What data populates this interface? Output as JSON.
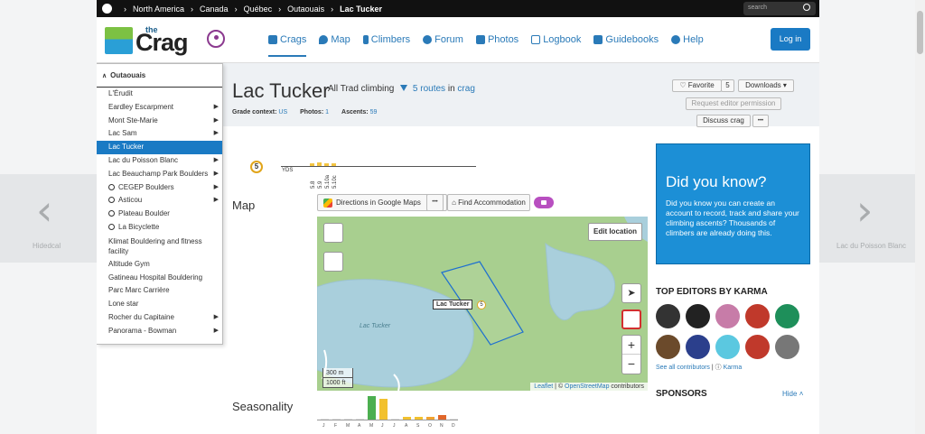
{
  "breadcrumb": {
    "items": [
      "North America",
      "Canada",
      "Québec",
      "Outaouais",
      "Lac Tucker"
    ]
  },
  "search": {
    "placeholder": "search"
  },
  "logo": {
    "the": "the",
    "name": "Crag"
  },
  "nav": {
    "items": [
      "Crags",
      "Map",
      "Climbers",
      "Forum",
      "Photos",
      "Logbook",
      "Guidebooks",
      "Help"
    ]
  },
  "login_label": "Log in",
  "side_nav": {
    "prev_label": "Hidedcal",
    "next_label": "Lac du Poisson Blanc"
  },
  "menu": {
    "heading": "Outaouais",
    "items": [
      {
        "label": "L'Érudit",
        "arrow": false,
        "banned": false
      },
      {
        "label": "Eardley Escarpment",
        "arrow": true,
        "banned": false
      },
      {
        "label": "Mont Ste-Marie",
        "arrow": true,
        "banned": false
      },
      {
        "label": "Lac Sam",
        "arrow": true,
        "banned": false
      },
      {
        "label": "Lac Tucker",
        "arrow": false,
        "banned": false,
        "active": true
      },
      {
        "label": "Lac du Poisson Blanc",
        "arrow": true,
        "banned": false
      },
      {
        "label": "Lac Beauchamp Park Boulders",
        "arrow": true,
        "banned": false
      },
      {
        "label": "CEGEP Boulders",
        "arrow": true,
        "banned": true
      },
      {
        "label": "Asticou",
        "arrow": true,
        "banned": true
      },
      {
        "label": "Plateau Boulder",
        "arrow": false,
        "banned": true
      },
      {
        "label": "La Bicyclette",
        "arrow": false,
        "banned": true
      },
      {
        "label": "Klimat Bouldering and fitness facility",
        "arrow": false,
        "banned": false,
        "two_line": true
      },
      {
        "label": "Altitude Gym",
        "arrow": false,
        "banned": false
      },
      {
        "label": "Gatineau Hospital Bouldering",
        "arrow": false,
        "banned": false
      },
      {
        "label": "Parc Marc Carrière",
        "arrow": false,
        "banned": false
      },
      {
        "label": "Lone star",
        "arrow": false,
        "banned": false
      },
      {
        "label": "Rocher du Capitaine",
        "arrow": true,
        "banned": false
      },
      {
        "label": "Panorama - Bowman",
        "arrow": true,
        "banned": false
      }
    ]
  },
  "crag": {
    "title": "Lac Tucker",
    "all_label": "All Trad climbing",
    "routes_link": "5 routes",
    "in_label": "in",
    "crag_link": "crag",
    "grade_context_label": "Grade context:",
    "grade_context_value": "US",
    "photos_label": "Photos:",
    "photos_value": "1",
    "ascents_label": "Ascents:",
    "ascents_value": "59"
  },
  "actions": {
    "favorite": "Favorite",
    "favorite_count": "5",
    "downloads": "Downloads",
    "request_editor": "Request editor permission",
    "discuss": "Discuss crag",
    "more": "•••"
  },
  "grade_chart": {
    "badge": "5",
    "system": "YDS",
    "grades": [
      "5.8",
      "5.9",
      "5.10a",
      "5.10c"
    ],
    "counts": [
      1,
      2,
      1,
      1
    ]
  },
  "map_section": {
    "heading": "Map",
    "directions_label": "Directions in Google Maps",
    "more": "•••",
    "accommodation_label": "Find Accommodation",
    "edit_location": "Edit location",
    "marker_label": "Lac Tucker",
    "marker_count": "5",
    "lake_label": "Lac Tucker",
    "scale_m": "300 m",
    "scale_ft": "1000 ft",
    "zoom_in": "+",
    "zoom_out": "−",
    "attr_leaflet": "Leaflet",
    "attr_sep": " | © ",
    "attr_osm": "OpenStreetMap",
    "attr_contrib": " contributors"
  },
  "seasonality": {
    "heading": "Seasonality",
    "months": [
      "J",
      "F",
      "M",
      "A",
      "M",
      "J",
      "J",
      "A",
      "S",
      "O",
      "N",
      "D"
    ],
    "values": [
      0,
      0,
      0,
      0,
      10,
      9,
      0,
      1,
      1,
      1,
      2,
      0
    ],
    "colors": [
      "#e2e2e2",
      "#e2e2e2",
      "#e2e2e2",
      "#e2e2e2",
      "#4caf50",
      "#f2c12e",
      "#e2e2e2",
      "#f2c12e",
      "#f2c12e",
      "#f2a32e",
      "#e1672a",
      "#e2e2e2"
    ]
  },
  "did_you_know": {
    "heading": "Did you know?",
    "body": "Did you know you can create an account to record, track and share your climbing ascents? Thousands of climbers are already doing this."
  },
  "top_editors": {
    "heading": "TOP EDITORS BY KARMA",
    "avatars": [
      "#333333",
      "#222222",
      "#c77ca8",
      "#c0392b",
      "#1e8f5a",
      "#6b4a2b",
      "#2b3f8c",
      "#5bc8e0",
      "#c0392b",
      "#777777"
    ],
    "see_all": "See all contributors",
    "sep": " | ",
    "karma": "Karma"
  },
  "sponsors": {
    "heading": "SPONSORS",
    "hide": "Hide"
  },
  "colors": {
    "accent": "#1a7ac4",
    "header_bar": "#111111",
    "map_green": "#a8cf8f",
    "lake_blue": "#a9cfdc"
  }
}
